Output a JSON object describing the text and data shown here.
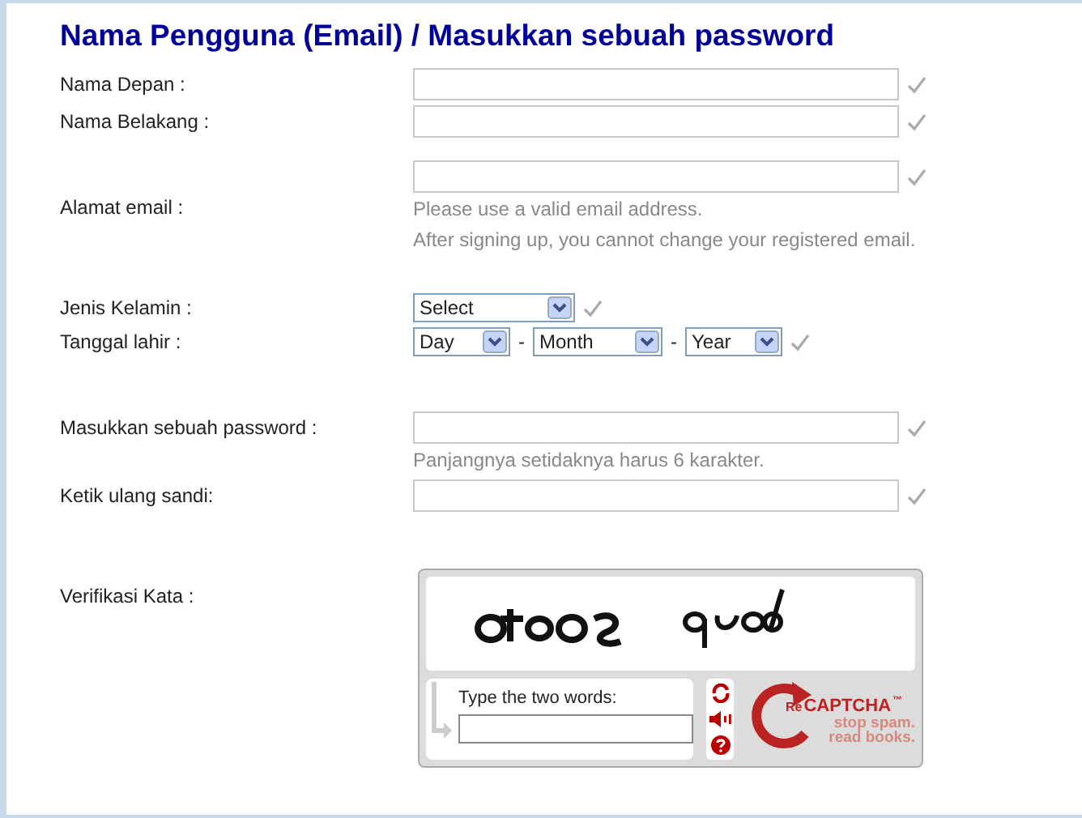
{
  "title": "Nama Pengguna (Email) / Masukkan sebuah password",
  "sections": [
    {
      "fields": [
        {
          "kind": "text",
          "label": "Nama Depan :"
        },
        {
          "kind": "text",
          "label": "Nama Belakang :"
        }
      ]
    },
    {
      "fields": [
        {
          "kind": "email",
          "label": "Alamat email :",
          "hints": [
            "Please use a valid email address.",
            "After signing up, you cannot change your registered email."
          ]
        }
      ]
    },
    {
      "fields": [
        {
          "kind": "select",
          "label": "Jenis Kelamin :",
          "selects": [
            {
              "value": "Select"
            }
          ]
        },
        {
          "kind": "select",
          "label": "Tanggal lahir :",
          "selects": [
            {
              "value": "Day"
            },
            {
              "value": "Month",
              "separator": "-"
            },
            {
              "value": "Year",
              "separator": "-"
            }
          ]
        }
      ]
    },
    {
      "fields": [
        {
          "kind": "password",
          "label": "Masukkan sebuah password :",
          "hints": [
            "Panjangnya setidaknya harus 6 karakter."
          ]
        },
        {
          "kind": "password",
          "label": "Ketik ulang sandi:"
        }
      ]
    },
    {
      "fields": [
        {
          "kind": "captcha",
          "label": "Verifikasi Kata :"
        }
      ]
    }
  ],
  "captcha": {
    "prompt": "Type the two words:",
    "brand_prefix": "Re",
    "brand": "CAPTCHA",
    "trademark": "™",
    "tagline": "stop spam. read books."
  }
}
